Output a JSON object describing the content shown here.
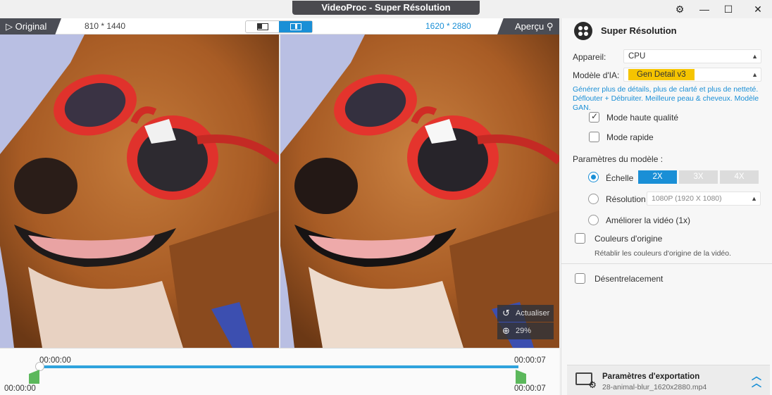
{
  "window": {
    "title": "VideoProc - Super Résolution",
    "settings_icon": "gear-icon",
    "minimize_icon": "minimize-icon",
    "maximize_icon": "maximize-icon",
    "close_icon": "close-icon"
  },
  "preview": {
    "original_label": "Original",
    "original_resolution": "810 * 1440",
    "output_resolution": "1620 * 2880",
    "apercu_label": "Aperçu",
    "refresh_label": "Actualiser",
    "zoom_label": "29%"
  },
  "timeline": {
    "start_time_top": "00:00:00",
    "end_time_top": "00:00:07",
    "start_time_bottom": "00:00:00",
    "end_time_bottom": "00:00:07"
  },
  "panel": {
    "title": "Super Résolution",
    "device_label": "Appareil:",
    "device_value": "CPU",
    "model_label": "Modèle d'IA:",
    "model_value": "Gen Detail v3",
    "model_desc": "Générer plus de détails, plus de clarté et plus de netteté. Déflouter + Débruiter. Meilleure peau & cheveux. Modèle GAN.",
    "hq_mode_label": "Mode haute qualité",
    "fast_mode_label": "Mode rapide",
    "model_params_label": "Paramètres du modèle :",
    "scale_label": "Échelle",
    "scale_options": [
      "2X",
      "3X",
      "4X"
    ],
    "resolution_label": "Résolution",
    "resolution_value": "1080P (1920 X 1080)",
    "improve_label": "Améliorer la vidéo (1x)",
    "original_colors_label": "Couleurs d'origine",
    "original_colors_note": "Rétablir les couleurs d'origine de la vidéo.",
    "deinterlace_label": "Désentrelacement",
    "export_title": "Paramètres d'exportation",
    "export_file": "28-animal-blur_1620x2880.mp4"
  },
  "colors": {
    "accent": "#1a8fd6",
    "badge": "#f5c400",
    "handle": "#5cb85c"
  }
}
